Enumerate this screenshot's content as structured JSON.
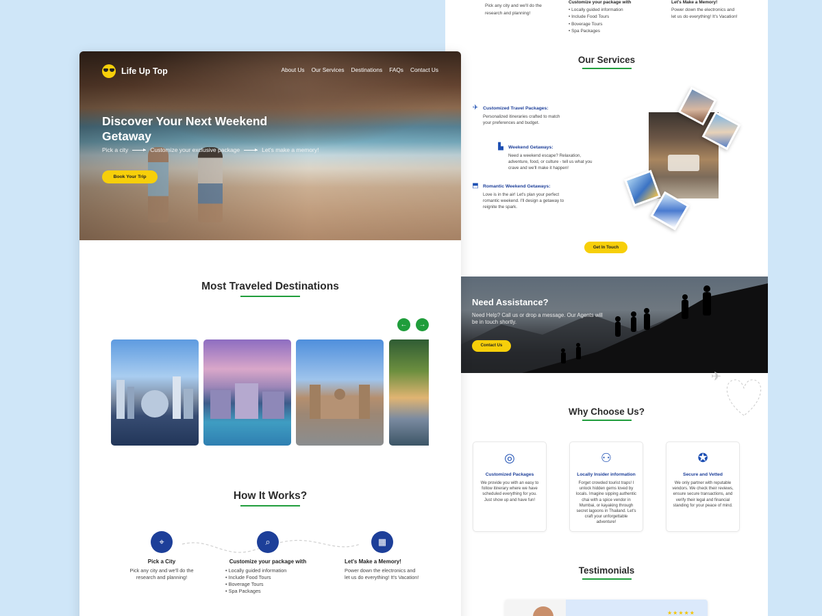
{
  "left_page": {
    "brand": "Life Up Top",
    "nav": [
      "About Us",
      "Our Services",
      "Destinations",
      "FAQs",
      "Contact Us"
    ],
    "hero": {
      "title": "Discover Your Next Weekend Getaway",
      "steps": [
        "Pick a city",
        "Customize your exclusive package",
        "Let's make a memory!"
      ],
      "cta": "Book Your Trip"
    },
    "destinations": {
      "title": "Most Traveled Destinations",
      "prev_icon": "arrow-left-icon",
      "next_icon": "arrow-right-icon"
    },
    "how": {
      "title": "How It Works?",
      "steps": [
        {
          "title": "Pick a City",
          "desc": "Pick any city and we'll do the research and planning!"
        },
        {
          "title": "Customize your package with",
          "items": [
            "Locally guided information",
            "Include Food Tours",
            "Boverage Tours",
            "Spa Packages"
          ]
        },
        {
          "title": "Let's Make a Memory!",
          "desc": "Power down the electronics and let us do everything! It's Vacation!"
        }
      ]
    }
  },
  "right_page": {
    "top_strip": {
      "col1": "Pick any city and we'll do the research and planning!",
      "col2_title": "Customize your package with",
      "col2_items": [
        "Locally guided information",
        "Include Food Tours",
        "Boverage Tours",
        "Spa Packages"
      ],
      "col3_title": "Let's Make a Memory!",
      "col3_desc": "Power down the electronics and let us do everything! It's Vacation!"
    },
    "services": {
      "title": "Our Services",
      "items": [
        {
          "title": "Customized Travel Packages:",
          "desc": "Personalized itineraries crafted to match your preferences and budget."
        },
        {
          "title": "Weekend Getaways:",
          "desc": "Need a weekend escape? Relaxation, adventure, food, or culture - tell us what you crave and we'll make it happen!"
        },
        {
          "title": "Romantic Weekend Getaways:",
          "desc": "Love is in the air! Let's plan your perfect romantic weekend. I'll design a getaway to reignite the spark."
        }
      ],
      "cta": "Get In Touch"
    },
    "assist": {
      "title": "Need Assistance?",
      "desc": "Need Help? Call us or drop a message. Our Agents will be in touch shortly.",
      "cta": "Contact Us"
    },
    "why": {
      "title": "Why Choose Us?",
      "cards": [
        {
          "title": "Customized Packages",
          "desc": "We provide you with an easy to follow itinerary where we have scheduled everything for you. Just show up and have fun!"
        },
        {
          "title": "Locally Insider information",
          "desc": "Forget crowded tourist traps! I unlock hidden gems loved by locals. Imagine sipping authentic chai with a spice vendor in Mumbai, or kayaking through secret lagoons in Thailand. Let's craft your unforgettable adventure!"
        },
        {
          "title": "Secure and Vetted",
          "desc": "We only partner with reputable vendors. We check their reviews, ensure secure transactions, and verify their legal and financial standing for your peace of mind."
        }
      ]
    },
    "testimonials": {
      "title": "Testimonials",
      "stars": "★★★★★"
    }
  },
  "colors": {
    "background": "#cfe6f8",
    "accent_yellow": "#f7cf0a",
    "accent_green": "#1f9d3b",
    "brand_blue": "#1d3f99"
  }
}
